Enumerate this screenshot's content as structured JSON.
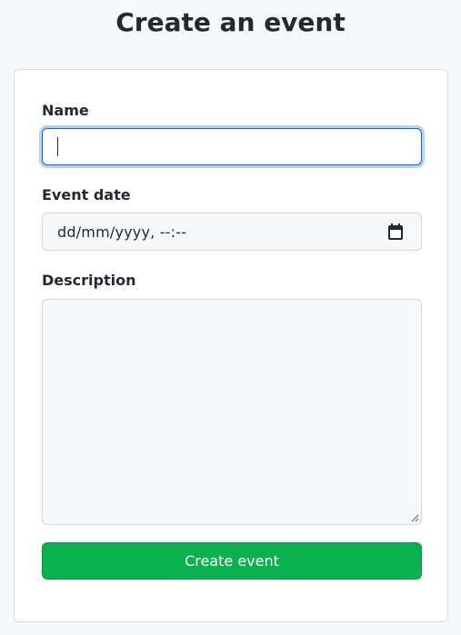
{
  "page": {
    "title": "Create an event"
  },
  "form": {
    "name_label": "Name",
    "name_value": "",
    "date_label": "Event date",
    "date_placeholder": "dd/mm/yyyy, --:--",
    "description_label": "Description",
    "description_value": "",
    "submit_label": "Create event"
  },
  "icons": {
    "date_picker": "calendar-icon",
    "textarea_resize": "resize-handle-icon"
  },
  "colors": {
    "background": "#f6f8fa",
    "focus_ring": "#0969da",
    "submit_button": "#0bb14f"
  }
}
